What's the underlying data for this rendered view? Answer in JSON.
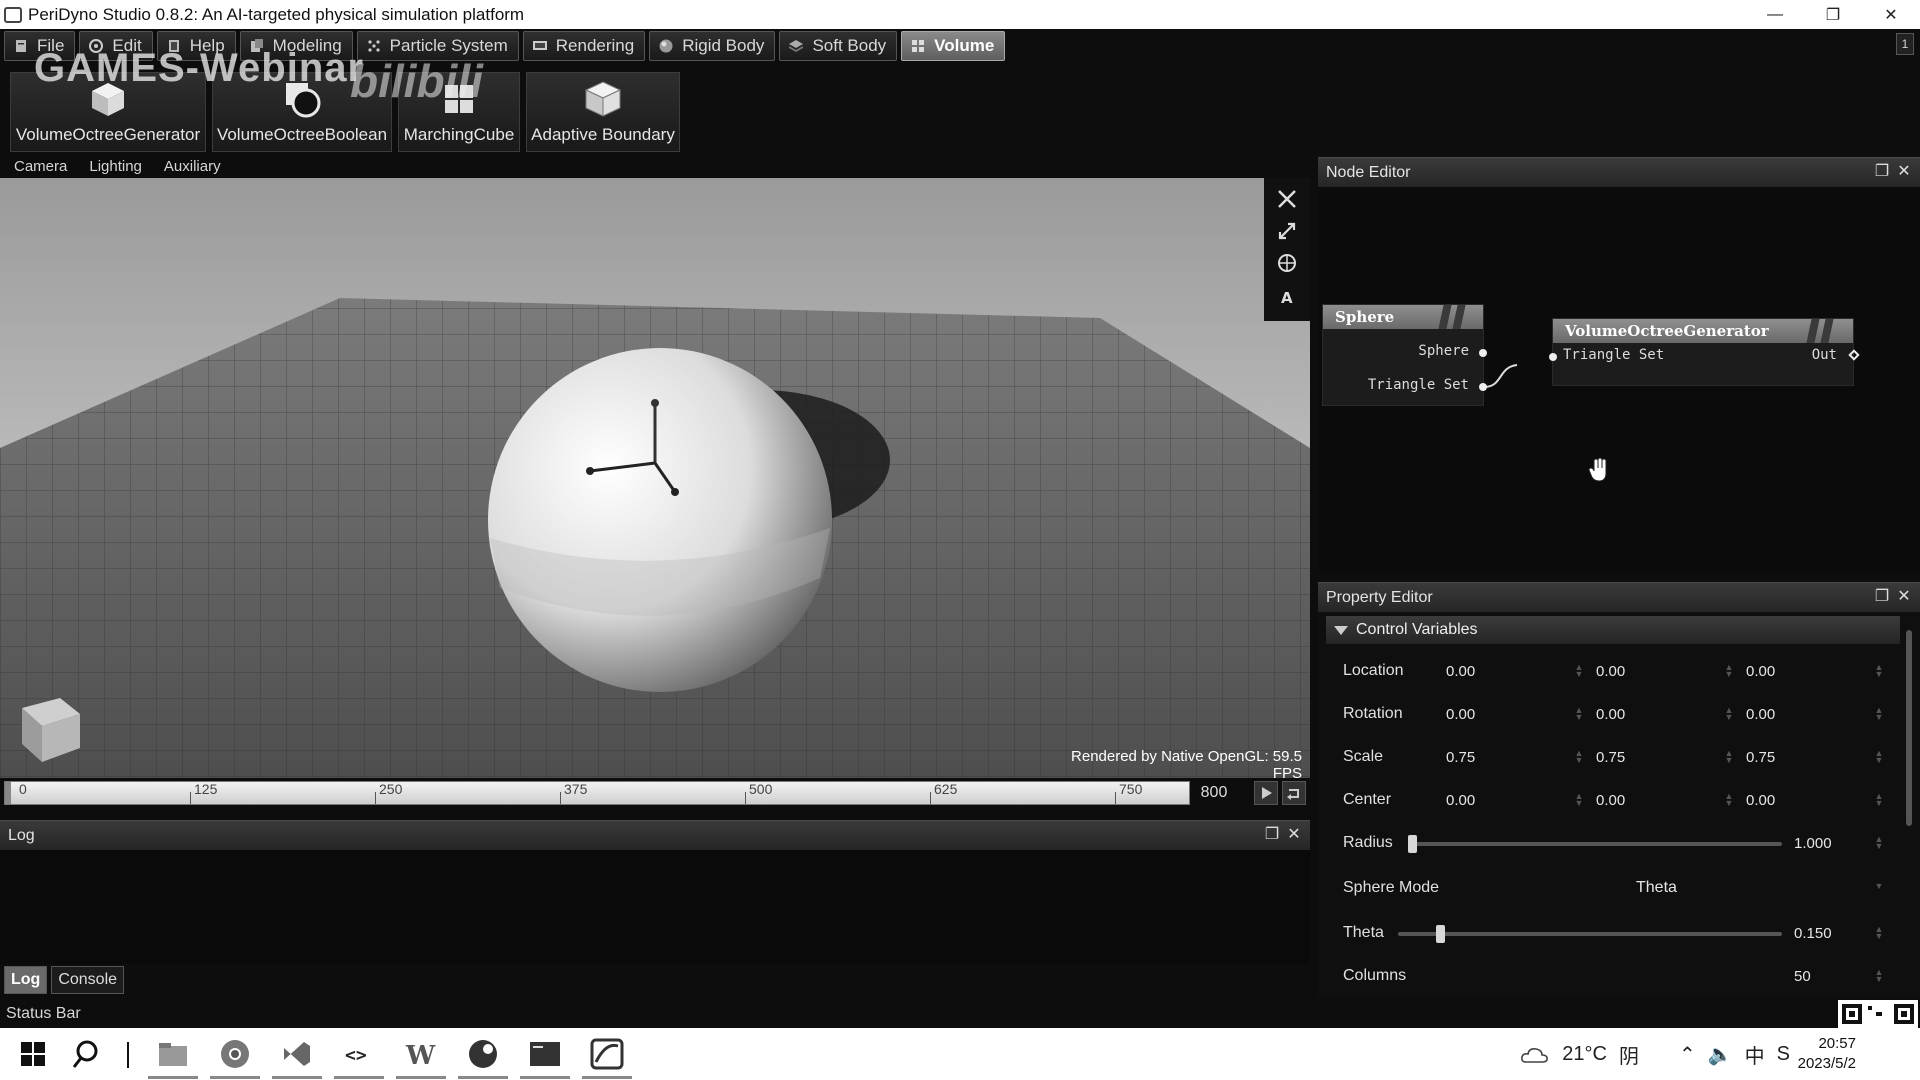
{
  "window": {
    "title": "PeriDyno Studio 0.8.2:  An AI-targeted physical simulation platform",
    "controls": [
      "minimize",
      "restore",
      "close"
    ]
  },
  "watermark": {
    "text": "GAMES-Webinar",
    "brand": "bilibili"
  },
  "menu_tabs": [
    {
      "label": "File",
      "icon": "file-icon"
    },
    {
      "label": "Edit",
      "icon": "edit-icon"
    },
    {
      "label": "Help",
      "icon": "help-icon"
    },
    {
      "label": "Modeling",
      "icon": "modeling-icon"
    },
    {
      "label": "Particle System",
      "icon": "particle-icon"
    },
    {
      "label": "Rendering",
      "icon": "rendering-icon"
    },
    {
      "label": "Rigid Body",
      "icon": "rigid-body-icon"
    },
    {
      "label": "Soft Body",
      "icon": "soft-body-icon"
    },
    {
      "label": "Volume",
      "icon": "volume-icon",
      "active": true
    }
  ],
  "toolbar": {
    "buttons": [
      {
        "label": "VolumeOctreeGenerator",
        "icon": "cube-icon"
      },
      {
        "label": "VolumeOctreeBoolean",
        "icon": "boolean-icon"
      },
      {
        "label": "MarchingCube",
        "icon": "marching-cube-icon"
      },
      {
        "label": "Adaptive Boundary",
        "icon": "boundary-box-icon"
      }
    ]
  },
  "viewport": {
    "menu": [
      "Camera",
      "Lighting",
      "Auxiliary"
    ],
    "fps_text": "Rendered by Native OpenGL: 59.5 FPS",
    "side_icons": [
      "fit-view-icon",
      "fullscreen-icon",
      "globe-icon",
      "text-a-icon"
    ]
  },
  "timeline": {
    "ticks": [
      "0",
      "125",
      "250",
      "375",
      "500",
      "625",
      "750"
    ],
    "end_frame": "800"
  },
  "log": {
    "title": "Log",
    "tabs": [
      "Log",
      "Console"
    ],
    "active_tab": "Log"
  },
  "status_bar": {
    "text": "Status Bar"
  },
  "node_editor": {
    "title": "Node Editor",
    "nodes": [
      {
        "name": "Sphere",
        "outputs": [
          "Sphere",
          "Triangle Set"
        ]
      },
      {
        "name": "VolumeOctreeGenerator",
        "inputs": [
          "Triangle Set"
        ],
        "outputs": [
          "Out"
        ]
      }
    ]
  },
  "property_editor": {
    "title": "Property Editor",
    "section": "Control Variables",
    "rows": [
      {
        "label": "Location",
        "values": [
          "0.00",
          "0.00",
          "0.00"
        ]
      },
      {
        "label": "Rotation",
        "values": [
          "0.00",
          "0.00",
          "0.00"
        ]
      },
      {
        "label": "Scale",
        "values": [
          "0.75",
          "0.75",
          "0.75"
        ]
      },
      {
        "label": "Center",
        "values": [
          "0.00",
          "0.00",
          "0.00"
        ]
      }
    ],
    "radius": {
      "label": "Radius",
      "value": "1.000",
      "fraction": 0.0
    },
    "sphere_mode": {
      "label": "Sphere Mode",
      "value": "Theta"
    },
    "theta": {
      "label": "Theta",
      "value": "0.150",
      "fraction": 0.1
    },
    "columns": {
      "label": "Columns",
      "value": "50"
    }
  },
  "taskbar": {
    "apps": [
      "windows-start-icon",
      "search-icon",
      "file-explorer-icon",
      "chrome-icon",
      "visual-studio-icon",
      "vscode-icon",
      "word-icon",
      "steam-icon",
      "terminal-icon",
      "peridyno-icon"
    ],
    "weather": {
      "temp": "21°C",
      "condition": "阴"
    },
    "ime": "中",
    "clock": {
      "time": "20:57",
      "date": "2023/5/2"
    }
  },
  "colors": {
    "background": "#0d0d0d",
    "panel_header": "#333333",
    "active_tab": "#6e6e6e",
    "title_bar": "#ffffff"
  }
}
